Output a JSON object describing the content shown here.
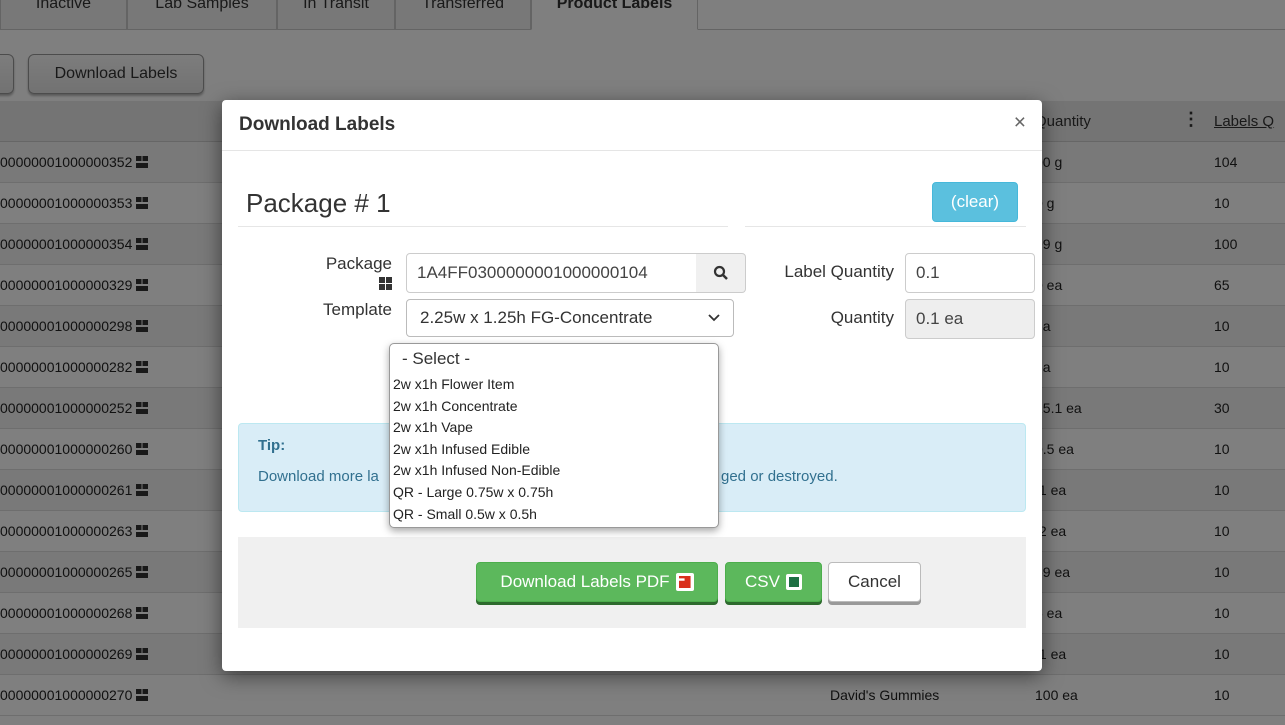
{
  "tabs": [
    "Inactive",
    "Lab Samples",
    "In Transit",
    "Transferred",
    "Product Labels"
  ],
  "toolbar": {
    "download_labels": "Download Labels"
  },
  "table": {
    "headers": {
      "quantity": "Quantity",
      "labels_q": "Labels Q"
    },
    "rows": [
      {
        "tag": "00000001000000352",
        "quantity": "00 g",
        "labels": "104"
      },
      {
        "tag": "00000001000000353",
        "quantity": "0 g",
        "labels": "10"
      },
      {
        "tag": "00000001000000354",
        "quantity": "99 g",
        "labels": "100"
      },
      {
        "tag": "00000001000000329",
        "quantity": "0 ea",
        "labels": "65"
      },
      {
        "tag": "00000001000000298",
        "quantity": "ea",
        "labels": "10"
      },
      {
        "tag": "00000001000000282",
        "quantity": "ea",
        "labels": "10"
      },
      {
        "tag": "00000001000000252",
        "quantity": "15.1 ea",
        "labels": "30"
      },
      {
        "tag": "00000001000000260",
        "quantity": "0.5 ea",
        "labels": "10"
      },
      {
        "tag": "00000001000000261",
        "quantity": ".1 ea",
        "labels": "10"
      },
      {
        "tag": "00000001000000263",
        "quantity": ".2 ea",
        "labels": "10"
      },
      {
        "tag": "00000001000000265",
        "quantity": "69 ea",
        "labels": "10"
      },
      {
        "tag": "00000001000000268",
        "quantity": "6 ea",
        "labels": "10"
      },
      {
        "tag": "00000001000000269",
        "quantity": ".1 ea",
        "labels": "10"
      },
      {
        "tag": "00000001000000270",
        "item": "David's Gummies",
        "quantity": "100 ea",
        "labels": "10"
      }
    ]
  },
  "modal": {
    "title": "Download Labels",
    "close": "×",
    "package_heading": "Package # 1",
    "clear_label": "(clear)",
    "package_label": "Package",
    "package_value": "1A4FF0300000001000000104",
    "template_label": "Template",
    "template_value": "2.25w x 1.25h FG-Concentrate",
    "label_quantity_label": "Label Quantity",
    "label_quantity_value": "0.1",
    "quantity_label": "Quantity",
    "quantity_value": "0.1 ea",
    "template_options": [
      "- Select -",
      "2w x1h Flower Item",
      "2w x1h Concentrate",
      "2w x1h Vape",
      "2w x1h Infused Edible",
      "2w x1h Infused Non-Edible",
      "QR - Large 0.75w x 0.75h",
      "QR - Small 0.5w x 0.5h"
    ],
    "tip_title": "Tip:",
    "tip_text_left": "Download more la",
    "tip_text_right": "ged or destroyed.",
    "download_pdf": "Download Labels PDF",
    "csv": "CSV",
    "cancel": "Cancel"
  }
}
